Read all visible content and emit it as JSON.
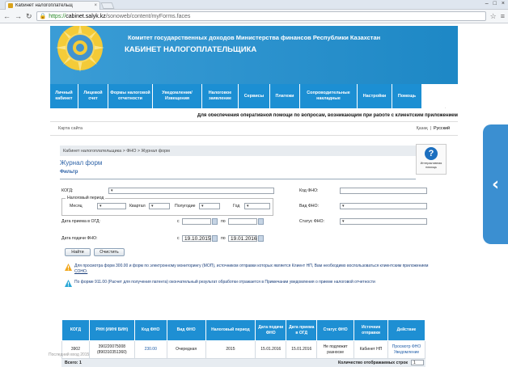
{
  "browser": {
    "tab_title": "Кабинет налогоплательщ",
    "url_https": "https://",
    "url_host": "cabinet.salyk.kz",
    "url_path": "/sonoweb/content/myForms.faces"
  },
  "header": {
    "line1": "Комитет государственных доходов Министерства финансов Республики Казахстан",
    "line2": "КАБИНЕТ НАЛОГОПЛАТЕЛЬЩИКА"
  },
  "menu": [
    "Личный кабинет",
    "Лицевой счет",
    "Формы налоговой отчетности",
    "Уведомления/ Извещения",
    "Налоговое заявление",
    "Сервисы",
    "Платежи",
    "Сопроводительные накладные",
    "Настройки",
    "Помощь"
  ],
  "notice": "Для обеспечения оперативной помощи по вопросам, возникающим при работе с клиентским приложением",
  "sitemap": "Карта сайта",
  "lang": {
    "kz": "Қазақ",
    "sep": "|",
    "ru": "Русский"
  },
  "breadcrumb": "Кабинет налогоплательщика > ФНО > Журнал форм",
  "help_label": "Интерактивная помощь",
  "page_title": "Журнал форм",
  "filter": {
    "title": "Фильтр",
    "kogd_label": "КОГД:",
    "kod_fno_label": "Код ФНО:",
    "period_legend": "Налоговый период",
    "month_label": "Месяц",
    "quarter_label": "Квартал",
    "halfyear_label": "Полугодие",
    "year_label": "Год",
    "vid_fno_label": "Вид ФНО:",
    "date_receive_label": "Дата приема в ОГД:",
    "from": "с",
    "to": "по",
    "status_label": "Статус ФНО:",
    "date_submit_label": "Дата подачи ФНО:",
    "date_from": "19.10.2015",
    "date_to": "19.01.2016",
    "find_button": "Найти",
    "clear_button": "Очистить"
  },
  "info1_text": "Для просмотра форм 300.00 и форм по электронному мониторингу (МОП), источником отправки которых является Клиент НП, Вам необходимо воспользоваться клиентским приложением ",
  "info1_link": "СОНО.",
  "info2": "По форме 911.00 (Расчет для получения патента) окончательный результат обработки отражается в Примечании уведомления о приеме налоговой отчетности",
  "table": {
    "headers": [
      "КОГД",
      "РНН (ИИН/ БИН)",
      "Код ФНО",
      "Вид ФНО",
      "Налоговый период",
      "Дата подачи ФНО",
      "Дата приема в ОГД",
      "Статус ФНО",
      "Источник отправки",
      "Действие"
    ],
    "row": [
      "3902",
      "390220075008 (890310351360)",
      "230.00",
      "Очередная",
      "2015",
      "15.01.2016",
      "15.01.2016",
      "Не подлежит разноске",
      "Кабинет НП",
      "Просмотр ФНО Уведомление"
    ],
    "total": "Всего: 1",
    "rows_count_label": "Количество отображаемых строк",
    "page_size": "1"
  },
  "footer": "Последний вход 2015"
}
